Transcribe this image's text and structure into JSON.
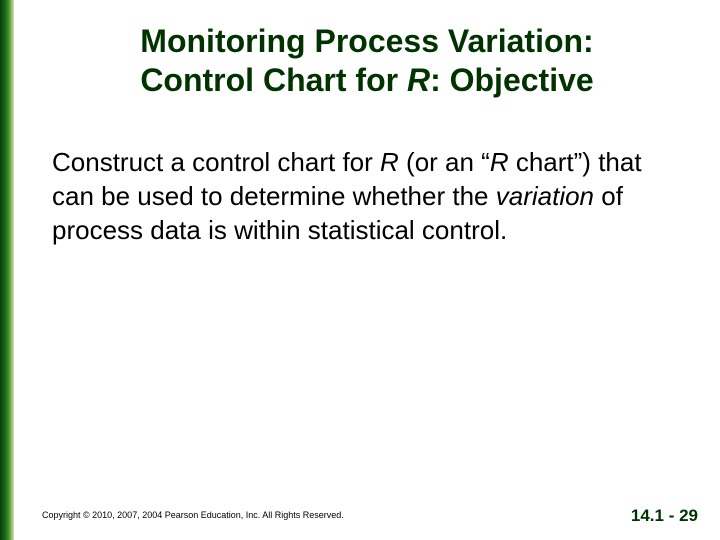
{
  "title": {
    "line1_a": "Monitoring Process Variation:",
    "line2_a": "Control Chart for ",
    "line2_r": "R",
    "line2_b": ": Objective"
  },
  "body": {
    "t1": "Construct a control chart for ",
    "r1": "R",
    "t2": " (or an “",
    "r2": "R",
    "t3": " chart”) that can be used to determine whether the ",
    "var": "variation",
    "t4": " of process data is within statistical control."
  },
  "footer": {
    "copyright": "Copyright © 2010, 2007, 2004 Pearson Education, Inc. All Rights Reserved.",
    "page": "14.1 - 29"
  }
}
